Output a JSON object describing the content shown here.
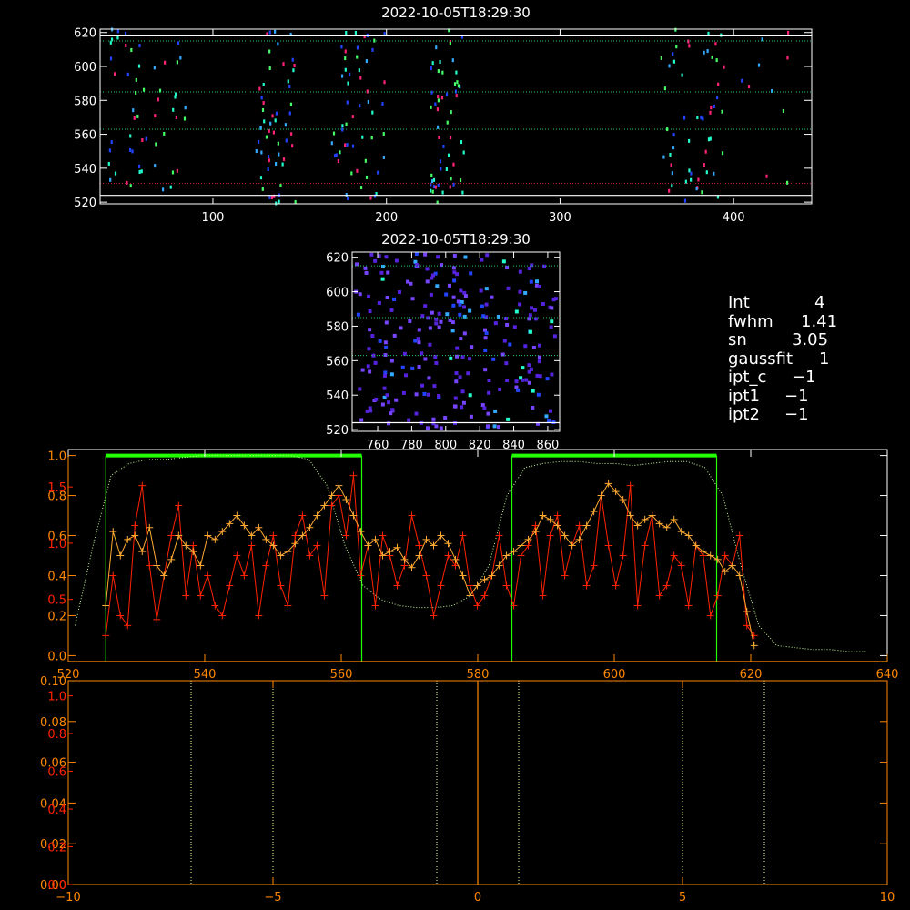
{
  "chart_data": [
    {
      "id": "overview",
      "type": "scatter",
      "title": "2022-10-05T18:29:30",
      "xlim": [
        35,
        445
      ],
      "ylim": [
        519,
        622
      ],
      "xticks": [
        "100",
        "200",
        "300",
        "400"
      ],
      "yticks": [
        "520",
        "540",
        "560",
        "580",
        "600",
        "620"
      ],
      "hlines_dotted": [
        {
          "y": 615,
          "color": "#22cc66"
        },
        {
          "y": 585,
          "color": "#22cc66"
        },
        {
          "y": 563,
          "color": "#22cc66"
        },
        {
          "y": 531,
          "color": "#cc2233"
        }
      ],
      "hlines_solid": [
        {
          "y": 618,
          "color": "#ffffff"
        },
        {
          "y": 524,
          "color": "#ffffff"
        }
      ],
      "columns": [
        {
          "x_min": 40,
          "x_max": 85
        },
        {
          "x_min": 125,
          "x_max": 148
        },
        {
          "x_min": 168,
          "x_max": 200
        },
        {
          "x_min": 225,
          "x_max": 245
        },
        {
          "x_min": 358,
          "x_max": 395
        },
        {
          "x_min": 398,
          "x_max": 432
        }
      ],
      "grid": false
    },
    {
      "id": "zoom",
      "type": "scatter",
      "title": "2022-10-05T18:29:30",
      "xlim": [
        745,
        867
      ],
      "ylim": [
        519,
        623
      ],
      "xticks": [
        "760",
        "780",
        "800",
        "820",
        "840",
        "860"
      ],
      "yticks": [
        "520",
        "540",
        "560",
        "580",
        "600",
        "620"
      ],
      "hlines_dotted": [
        {
          "y": 615,
          "color": "#22cc66"
        },
        {
          "y": 585,
          "color": "#22cc66"
        },
        {
          "y": 563,
          "color": "#22cc66"
        }
      ],
      "hlines_solid": [
        {
          "y": 524,
          "color": "#ffffff"
        }
      ],
      "grid": false
    },
    {
      "id": "profile",
      "type": "line",
      "xlim": [
        520,
        640
      ],
      "ylim": [
        -0.03,
        1.03
      ],
      "xticks": [
        "520",
        "540",
        "560",
        "580",
        "600",
        "620",
        "640"
      ],
      "yticks_left_orange": [
        "0.0",
        "0.2",
        "0.4",
        "0.6",
        "0.8",
        "1.0"
      ],
      "yticks_left_red": [
        "0.5",
        "1.0",
        "1.5"
      ],
      "green_boxes": [
        [
          525.5,
          563
        ],
        [
          585,
          615
        ]
      ],
      "series": [
        {
          "color": "#ff2200",
          "values": [
            0.1,
            0.4,
            0.2,
            0.15,
            0.65,
            0.85,
            0.45,
            0.18,
            0.4,
            0.6,
            0.75,
            0.3,
            0.55,
            0.3,
            0.4,
            0.25,
            0.2,
            0.35,
            0.5,
            0.4,
            0.55,
            0.2,
            0.45,
            0.6,
            0.35,
            0.25,
            0.6,
            0.7,
            0.5,
            0.55,
            0.3,
            0.75,
            0.8,
            0.6,
            0.9,
            0.4,
            0.55,
            0.25,
            0.6,
            0.5,
            0.35,
            0.45,
            0.7,
            0.55,
            0.4,
            0.2,
            0.35,
            0.5,
            0.45,
            0.6,
            0.35,
            0.25,
            0.3,
            0.4,
            0.6,
            0.35,
            0.25,
            0.5,
            0.55,
            0.65,
            0.3,
            0.6,
            0.7,
            0.4,
            0.55,
            0.65,
            0.35,
            0.45,
            0.8,
            0.55,
            0.35,
            0.5,
            0.85,
            0.25,
            0.55,
            0.7,
            0.3,
            0.35,
            0.5,
            0.45,
            0.25,
            0.55,
            0.5,
            0.2,
            0.3,
            0.5,
            0.45,
            0.6,
            0.15,
            0.1
          ]
        },
        {
          "color": "#ffaa33",
          "values": [
            0.25,
            0.62,
            0.5,
            0.58,
            0.6,
            0.52,
            0.64,
            0.45,
            0.4,
            0.48,
            0.6,
            0.55,
            0.52,
            0.45,
            0.6,
            0.58,
            0.62,
            0.66,
            0.7,
            0.65,
            0.6,
            0.64,
            0.58,
            0.55,
            0.5,
            0.52,
            0.56,
            0.6,
            0.64,
            0.7,
            0.75,
            0.8,
            0.85,
            0.78,
            0.7,
            0.62,
            0.55,
            0.58,
            0.5,
            0.52,
            0.54,
            0.48,
            0.44,
            0.5,
            0.58,
            0.55,
            0.6,
            0.56,
            0.48,
            0.4,
            0.3,
            0.35,
            0.38,
            0.4,
            0.45,
            0.5,
            0.52,
            0.55,
            0.58,
            0.62,
            0.7,
            0.68,
            0.65,
            0.6,
            0.55,
            0.58,
            0.65,
            0.72,
            0.8,
            0.86,
            0.82,
            0.78,
            0.7,
            0.65,
            0.68,
            0.7,
            0.66,
            0.64,
            0.68,
            0.62,
            0.6,
            0.55,
            0.52,
            0.5,
            0.48,
            0.42,
            0.45,
            0.4,
            0.22,
            0.05
          ]
        },
        {
          "color": "#ccff99",
          "dotted": true,
          "values": [
            0.15,
            0.55,
            0.9,
            0.96,
            0.98,
            0.98,
            0.99,
            1.0,
            1.0,
            1.0,
            1.0,
            1.0,
            1.0,
            0.98,
            0.85,
            0.55,
            0.35,
            0.28,
            0.25,
            0.24,
            0.24,
            0.25,
            0.3,
            0.45,
            0.8,
            0.94,
            0.96,
            0.97,
            0.97,
            0.96,
            0.96,
            0.95,
            0.96,
            0.97,
            0.97,
            0.94,
            0.8,
            0.45,
            0.15,
            0.05,
            0.04,
            0.03,
            0.03,
            0.02,
            0.02
          ]
        }
      ],
      "grid": false
    },
    {
      "id": "residual",
      "type": "line",
      "xlim": [
        -10,
        10
      ],
      "ylim": [
        0,
        0.1
      ],
      "xticks": [
        "−10",
        "−5",
        "0",
        "5",
        "10"
      ],
      "yticks_orange": [
        "0.00",
        "0.02",
        "0.04",
        "0.06",
        "0.08",
        "0.10"
      ],
      "yticks_red": [
        "0.0",
        "0.2",
        "0.4",
        "0.6",
        "0.8",
        "1.0"
      ],
      "vlines_dotted": [
        -7,
        -5,
        -1,
        1,
        5,
        7
      ],
      "vline_solid": 0,
      "grid": false
    }
  ],
  "stats": [
    {
      "label": "Int",
      "value": "4"
    },
    {
      "label": "fwhm",
      "value": "1.41"
    },
    {
      "label": "sn",
      "value": "3.05"
    },
    {
      "label": "gaussfit",
      "value": "1"
    },
    {
      "label": "ipt_c",
      "value": "−1"
    },
    {
      "label": "ipt1",
      "value": "−1"
    },
    {
      "label": "ipt2",
      "value": "−1"
    }
  ],
  "colors": {
    "background": "#000000",
    "axes_white": "#ffffff",
    "axes_orange": "#ff8800",
    "red": "#ff2200",
    "green_box": "#22ff00",
    "palette": [
      "#2244ff",
      "#33aaff",
      "#22ffcc",
      "#44ff66",
      "#ff2277",
      "#ffffff",
      "#5522dd",
      "#7744ff"
    ]
  }
}
